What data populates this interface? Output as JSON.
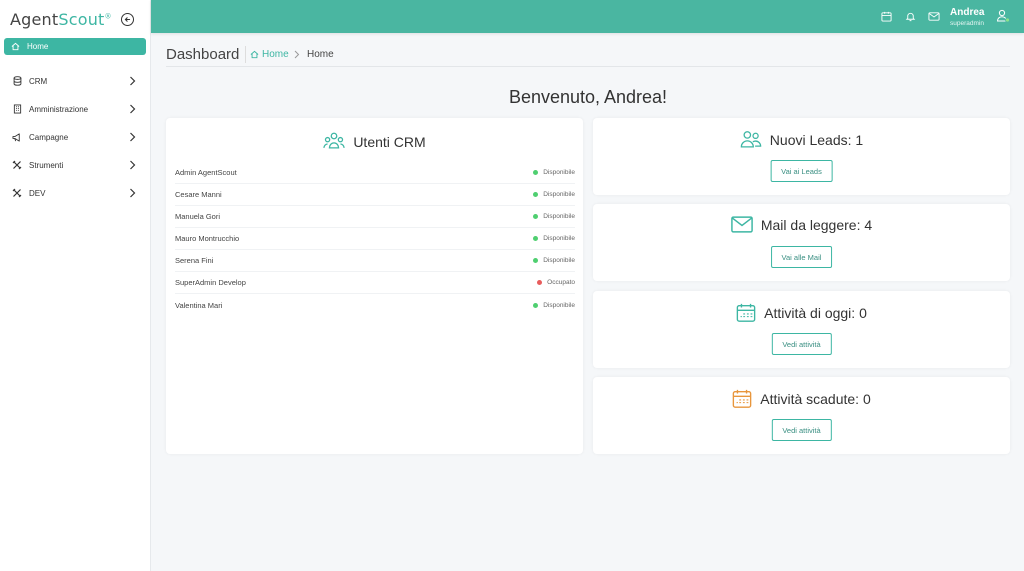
{
  "app": {
    "logo_main": "Agent",
    "logo_accent": "Scout",
    "logo_reg": "®"
  },
  "sidebar": {
    "items": [
      {
        "label": "Home",
        "icon": "home-icon",
        "active": true
      },
      {
        "label": "CRM",
        "icon": "database-icon"
      },
      {
        "label": "Amministrazione",
        "icon": "building-icon"
      },
      {
        "label": "Campagne",
        "icon": "megaphone-icon"
      },
      {
        "label": "Strumenti",
        "icon": "tools-icon"
      },
      {
        "label": "DEV",
        "icon": "tools-icon"
      }
    ]
  },
  "topbar": {
    "user_name": "Andrea",
    "user_role": "superadmin"
  },
  "page": {
    "title": "Dashboard",
    "breadcrumb_home": "Home",
    "breadcrumb_current": "Home",
    "welcome": "Benvenuto, Andrea!"
  },
  "crm_users": {
    "title": "Utenti CRM",
    "rows": [
      {
        "name": "Admin AgentScout",
        "status": "Disponibile",
        "status_color": "#4fcf70"
      },
      {
        "name": "Cesare Manni",
        "status": "Disponibile",
        "status_color": "#4fcf70"
      },
      {
        "name": "Manuela Gori",
        "status": "Disponibile",
        "status_color": "#4fcf70"
      },
      {
        "name": "Mauro Montrucchio",
        "status": "Disponibile",
        "status_color": "#4fcf70"
      },
      {
        "name": "Serena Fini",
        "status": "Disponibile",
        "status_color": "#4fcf70"
      },
      {
        "name": "SuperAdmin Develop",
        "status": "Occupato",
        "status_color": "#e85c5c"
      },
      {
        "name": "Valentina Mari",
        "status": "Disponibile",
        "status_color": "#4fcf70"
      }
    ]
  },
  "stats": [
    {
      "title": "Nuovi Leads: 1",
      "button": "Vai ai Leads",
      "icon": "users-icon"
    },
    {
      "title": "Mail da leggere: 4",
      "button": "Vai alle Mail",
      "icon": "mail-icon"
    },
    {
      "title": "Attività di oggi: 0",
      "button": "Vedi attività",
      "icon": "calendar-icon"
    },
    {
      "title": "Attività scadute: 0",
      "button": "Vedi attività",
      "icon": "calendar-overdue-icon"
    }
  ],
  "colors": {
    "accent": "#3db6a3",
    "topbar": "#4ab6a1",
    "available": "#4fcf70",
    "busy": "#e85c5c",
    "overdue": "#e8963c"
  }
}
